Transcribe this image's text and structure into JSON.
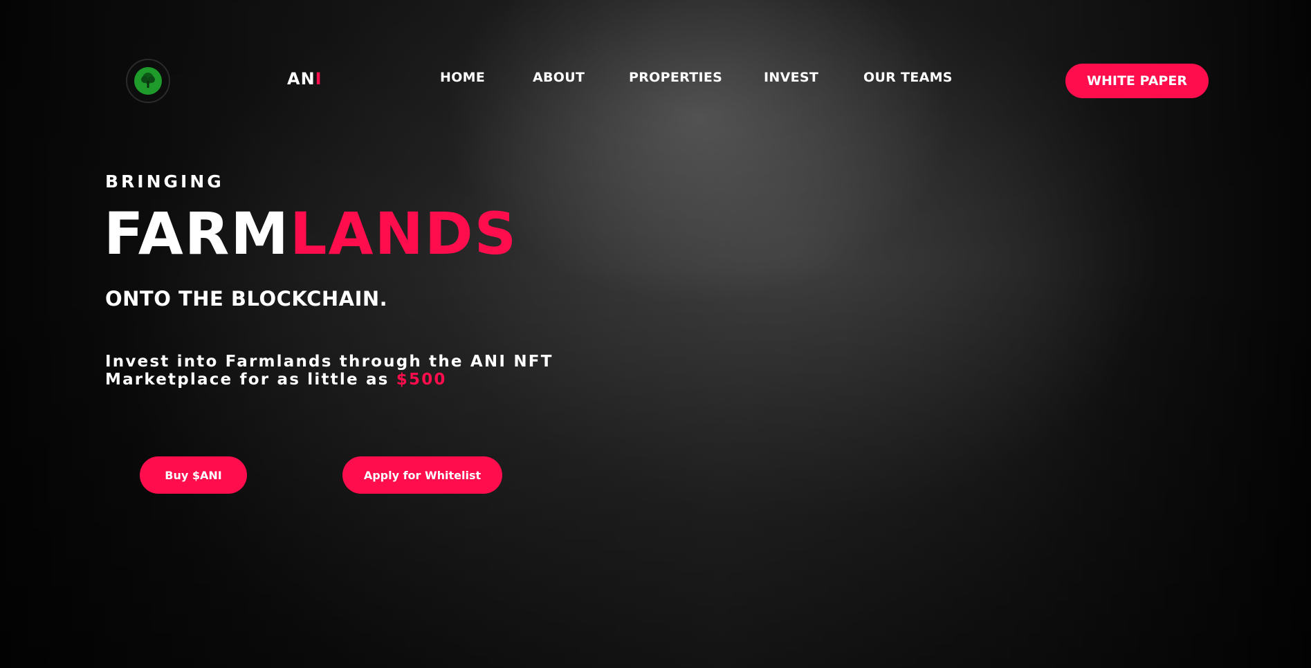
{
  "brand": {
    "logo_icon": "tree-icon",
    "name_main": "AN",
    "name_accent": "I"
  },
  "nav": {
    "items": [
      {
        "label": "HOME"
      },
      {
        "label": "ABOUT"
      },
      {
        "label": "PROPERTIES"
      },
      {
        "label": "INVEST"
      },
      {
        "label": "OUR TEAMS"
      }
    ],
    "cta_label": "WHITE PAPER"
  },
  "hero": {
    "kicker": "BRINGING",
    "headline_main": "FARM",
    "headline_accent": "LANDS",
    "subhead": "ONTO THE BLOCKCHAIN.",
    "lead_line1": "Invest into Farmlands through the ANI NFT",
    "lead_line2": "Marketplace for as little as ",
    "lead_price": "$500",
    "buttons": {
      "buy_label": "Buy $ANI",
      "whitelist_label": "Apply for Whitelist"
    }
  },
  "colors": {
    "accent": "#ff0d4d",
    "background": "#0b0b0b",
    "text": "#ffffff",
    "logo_green": "#1f9b2c"
  }
}
